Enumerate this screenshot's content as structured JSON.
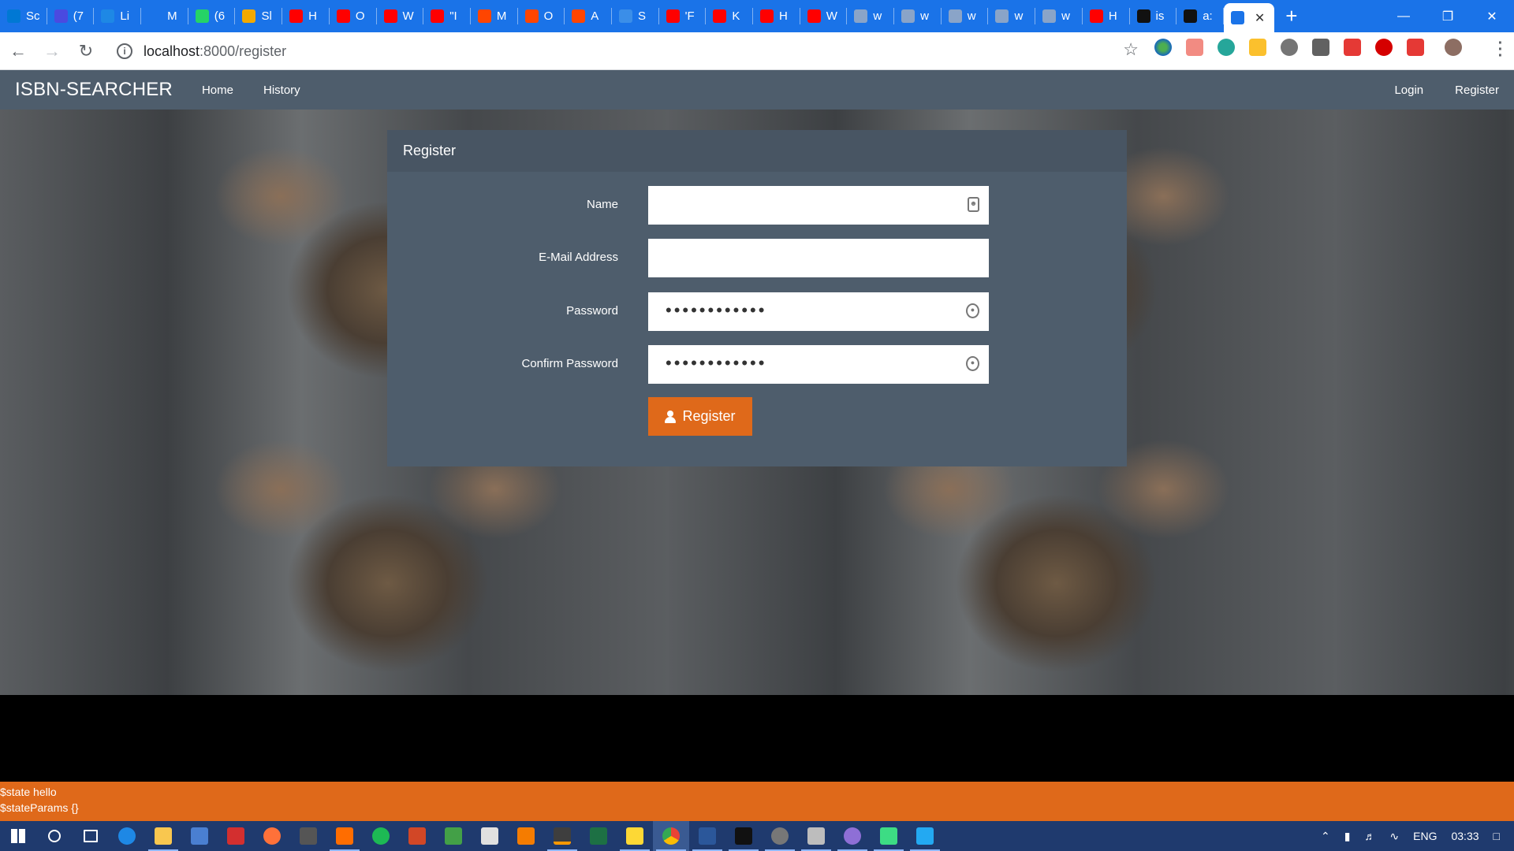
{
  "browser": {
    "tabs": [
      {
        "title": "Sc",
        "icon": "skype-icon",
        "color": "#0078d4"
      },
      {
        "title": "(7",
        "icon": "mail-icon",
        "color": "#4a4ae0"
      },
      {
        "title": "Li",
        "icon": "check-icon",
        "color": "#1e88e5"
      },
      {
        "title": "M",
        "icon": "wave-icon",
        "color": "#1a73e8"
      },
      {
        "title": "(6",
        "icon": "whatsapp-icon",
        "color": "#25d366"
      },
      {
        "title": "Sl",
        "icon": "bird-icon",
        "color": "#f2a900"
      },
      {
        "title": "H",
        "icon": "youtube-icon",
        "color": "#ff0000"
      },
      {
        "title": "O",
        "icon": "youtube-icon",
        "color": "#ff0000"
      },
      {
        "title": "W",
        "icon": "youtube-icon",
        "color": "#ff0000"
      },
      {
        "title": "\"I",
        "icon": "youtube-icon",
        "color": "#ff0000"
      },
      {
        "title": "M",
        "icon": "reddit-icon",
        "color": "#ff4500"
      },
      {
        "title": "O",
        "icon": "reddit-icon",
        "color": "#ff4500"
      },
      {
        "title": "A",
        "icon": "reddit-icon",
        "color": "#ff4500"
      },
      {
        "title": "S",
        "icon": "ss-icon",
        "color": "#3b8ee8"
      },
      {
        "title": "'F",
        "icon": "youtube-icon",
        "color": "#ff0000"
      },
      {
        "title": "K",
        "icon": "youtube-icon",
        "color": "#ff0000"
      },
      {
        "title": "H",
        "icon": "youtube-icon",
        "color": "#ff0000"
      },
      {
        "title": "W",
        "icon": "youtube-icon",
        "color": "#ff0000"
      },
      {
        "title": "w",
        "icon": "globe-icon",
        "color": "#8aa4c8"
      },
      {
        "title": "w",
        "icon": "globe-icon",
        "color": "#8aa4c8"
      },
      {
        "title": "w",
        "icon": "globe-icon",
        "color": "#8aa4c8"
      },
      {
        "title": "w",
        "icon": "globe-icon",
        "color": "#8aa4c8"
      },
      {
        "title": "w",
        "icon": "globe-icon",
        "color": "#8aa4c8"
      },
      {
        "title": "H",
        "icon": "youtube-icon",
        "color": "#ff0000"
      },
      {
        "title": "is",
        "icon": "github-icon",
        "color": "#111111"
      },
      {
        "title": "a:",
        "icon": "github-icon",
        "color": "#111111"
      }
    ],
    "active_tab": {
      "icon": "skype-icon",
      "color": "#1a73e8"
    },
    "new_tab_label": "+",
    "url_host": "localhost",
    "url_path": ":8000/register"
  },
  "navbar": {
    "brand": "ISBN-SEARCHER",
    "links": [
      "Home",
      "History"
    ],
    "right_links": [
      "Login",
      "Register"
    ]
  },
  "panel": {
    "heading": "Register",
    "fields": [
      {
        "label": "Name",
        "value": ""
      },
      {
        "label": "E-Mail Address",
        "value": ""
      },
      {
        "label": "Password",
        "value": "••••••••••••"
      },
      {
        "label": "Confirm Password",
        "value": "••••••••••••"
      }
    ],
    "submit_label": "Register"
  },
  "debug": {
    "line1": "$state hello",
    "line2": "$stateParams {}"
  },
  "taskbar": {
    "language": "ENG",
    "time": "03:33"
  },
  "colors": {
    "navbar": "#4e5d6c",
    "accent": "#df691a",
    "chrome": "#1a73e8"
  }
}
